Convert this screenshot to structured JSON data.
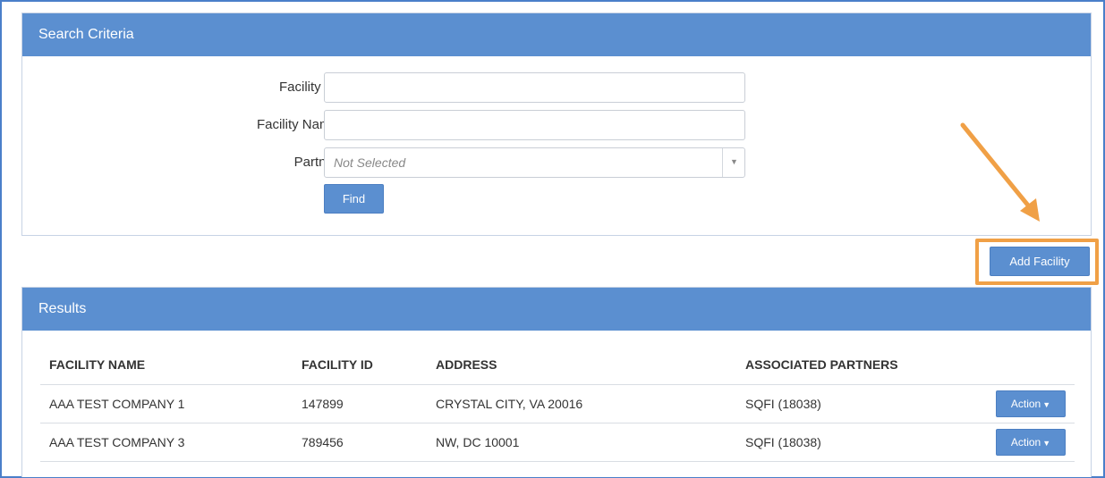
{
  "search": {
    "title": "Search Criteria",
    "fields": {
      "facility_id": {
        "label": "Facility ID:",
        "value": "",
        "placeholder": ""
      },
      "facility_name": {
        "label": "Facility Name:",
        "value": "",
        "placeholder": ""
      },
      "partner": {
        "label": "Partner:",
        "selected": "Not Selected"
      }
    },
    "find_label": "Find"
  },
  "add_facility_label": "Add Facility",
  "results": {
    "title": "Results",
    "columns": [
      "FACILITY NAME",
      "FACILITY ID",
      "ADDRESS",
      "ASSOCIATED PARTNERS"
    ],
    "rows": [
      {
        "name": "AAA TEST COMPANY 1",
        "id": "147899",
        "address": "CRYSTAL CITY, VA 20016",
        "partners": "SQFI (18038)",
        "action": "Action"
      },
      {
        "name": "AAA TEST COMPANY 3",
        "id": "789456",
        "address": "NW, DC 10001",
        "partners": "SQFI (18038)",
        "action": "Action"
      }
    ]
  },
  "colors": {
    "header_blue": "#5b8fd0",
    "highlight_orange": "#f0a046",
    "arrow_orange": "#f0a046"
  },
  "icons": {
    "select_arrow": "chevron-down-icon",
    "action_caret": "caret-down-icon",
    "annotation": "arrow-icon"
  }
}
